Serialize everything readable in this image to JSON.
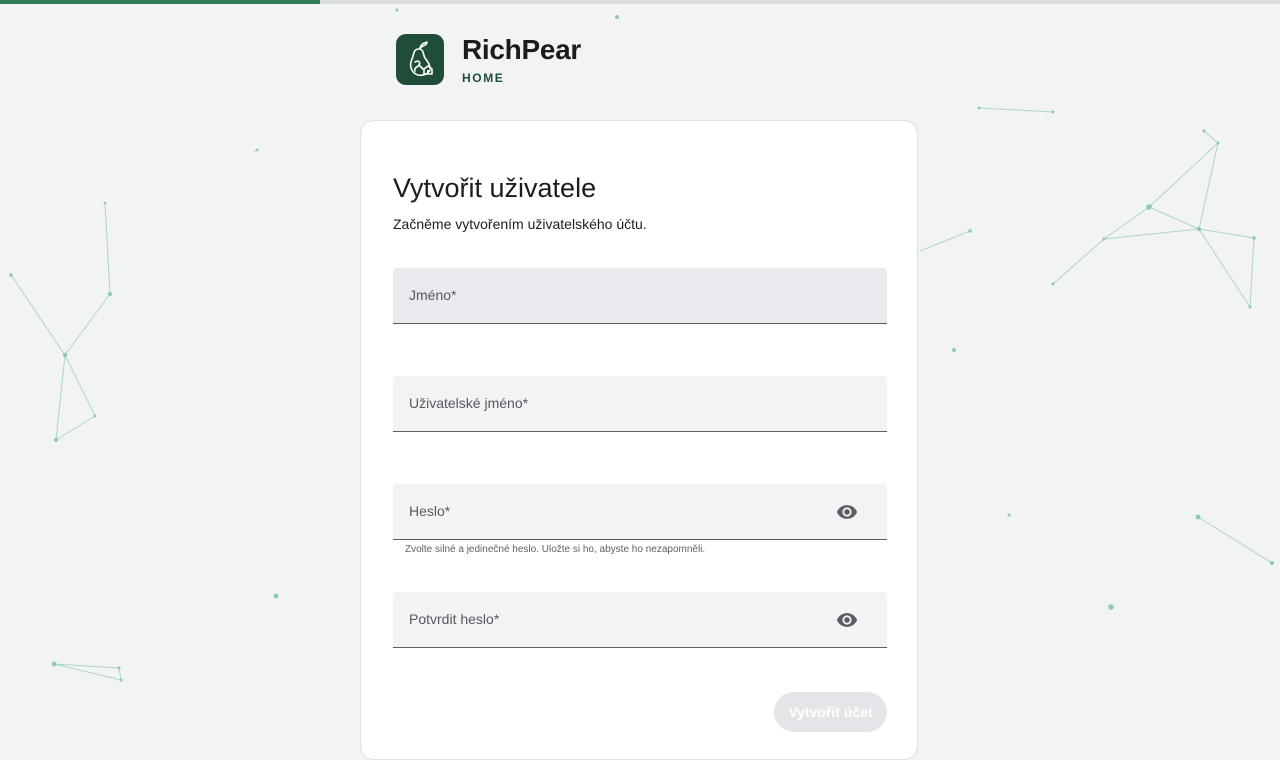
{
  "progress": {
    "percent": 25
  },
  "brand": {
    "name": "RichPear",
    "sub": "HOME",
    "logo_icon": "pear-house-logo-icon",
    "color": "#1f4d38"
  },
  "form": {
    "title": "Vytvořit uživatele",
    "subtitle": "Začněme vytvořením uživatelského účtu.",
    "fields": {
      "name": {
        "label": "Jméno*"
      },
      "username": {
        "label": "Uživatelské jméno*"
      },
      "password": {
        "label": "Heslo*",
        "hint": "Zvolte silné a jedinečné heslo. Uložte si ho, abyste ho nezapomněli.",
        "toggle_icon": "eye-icon"
      },
      "confirm": {
        "label": "Potvrdit heslo*",
        "toggle_icon": "eye-icon"
      }
    },
    "submit_label": "Vytvořit účet",
    "submit_state": "disabled"
  },
  "colors": {
    "accent": "#2e7d57",
    "background": "#f2f3f5",
    "network": "#8fcab0"
  }
}
